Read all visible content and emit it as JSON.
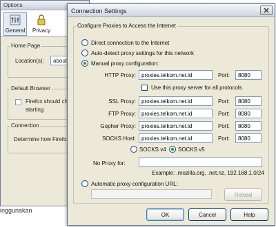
{
  "desktop": {
    "trailing_text": "inggunakan"
  },
  "options_window": {
    "title": "Options",
    "tabs": [
      {
        "label": "General",
        "icon": "general-settings-icon",
        "active": true
      },
      {
        "label": "Privacy",
        "icon": "privacy-mask-icon",
        "active": false
      }
    ],
    "home_page": {
      "title": "Home Page",
      "location_label": "Location(s):",
      "location_value": "about:blank"
    },
    "default_browser": {
      "title": "Default Browser",
      "check_text": "Firefox should check",
      "check_text_2": "starting"
    },
    "connection": {
      "title": "Connection",
      "description": "Determine how Firefox connects"
    }
  },
  "dialog": {
    "title": "Connection Settings",
    "legend": "Configure Proxies to Access the Internet",
    "options": {
      "direct": "Direct connection to the Internet",
      "auto_detect": "Auto-detect proxy settings for this network",
      "manual": "Manual proxy configuration:",
      "automatic_url": "Automatic proxy configuration URL:"
    },
    "selected_option": "manual",
    "port_label": "Port:",
    "proxies": [
      {
        "label": "HTTP Proxy:",
        "host": "proxies.telkom.net.id",
        "port": "8080"
      },
      {
        "label": "SSL Proxy:",
        "host": "proxies.telkom.net.id",
        "port": "8080"
      },
      {
        "label": "FTP Proxy:",
        "host": "proxies.telkom.net.id",
        "port": "8080"
      },
      {
        "label": "Gopher Proxy:",
        "host": "proxies.telkom.net.id",
        "port": "8080"
      },
      {
        "label": "SOCKS Host:",
        "host": "proxies.telkom.net.id",
        "port": "8080"
      }
    ],
    "use_for_all_label": "Use this proxy server for all protocols",
    "use_for_all_checked": false,
    "socks_v4_label": "SOCKS v4",
    "socks_v5_label": "SOCKS v5",
    "socks_selected": "v5",
    "no_proxy_label": "No Proxy for:",
    "no_proxy_value": "",
    "example_text": "Example: .mozilla.org, .net.nz, 192.168.1.0/24",
    "auto_url_value": "",
    "reload_label": "Reload",
    "buttons": {
      "ok": "OK",
      "cancel": "Cancel",
      "help": "Help"
    }
  },
  "colors": {
    "radio_selected": "#2a9a2a",
    "field_border": "#7f9db9",
    "dialog_bg": "#ece9d8"
  }
}
